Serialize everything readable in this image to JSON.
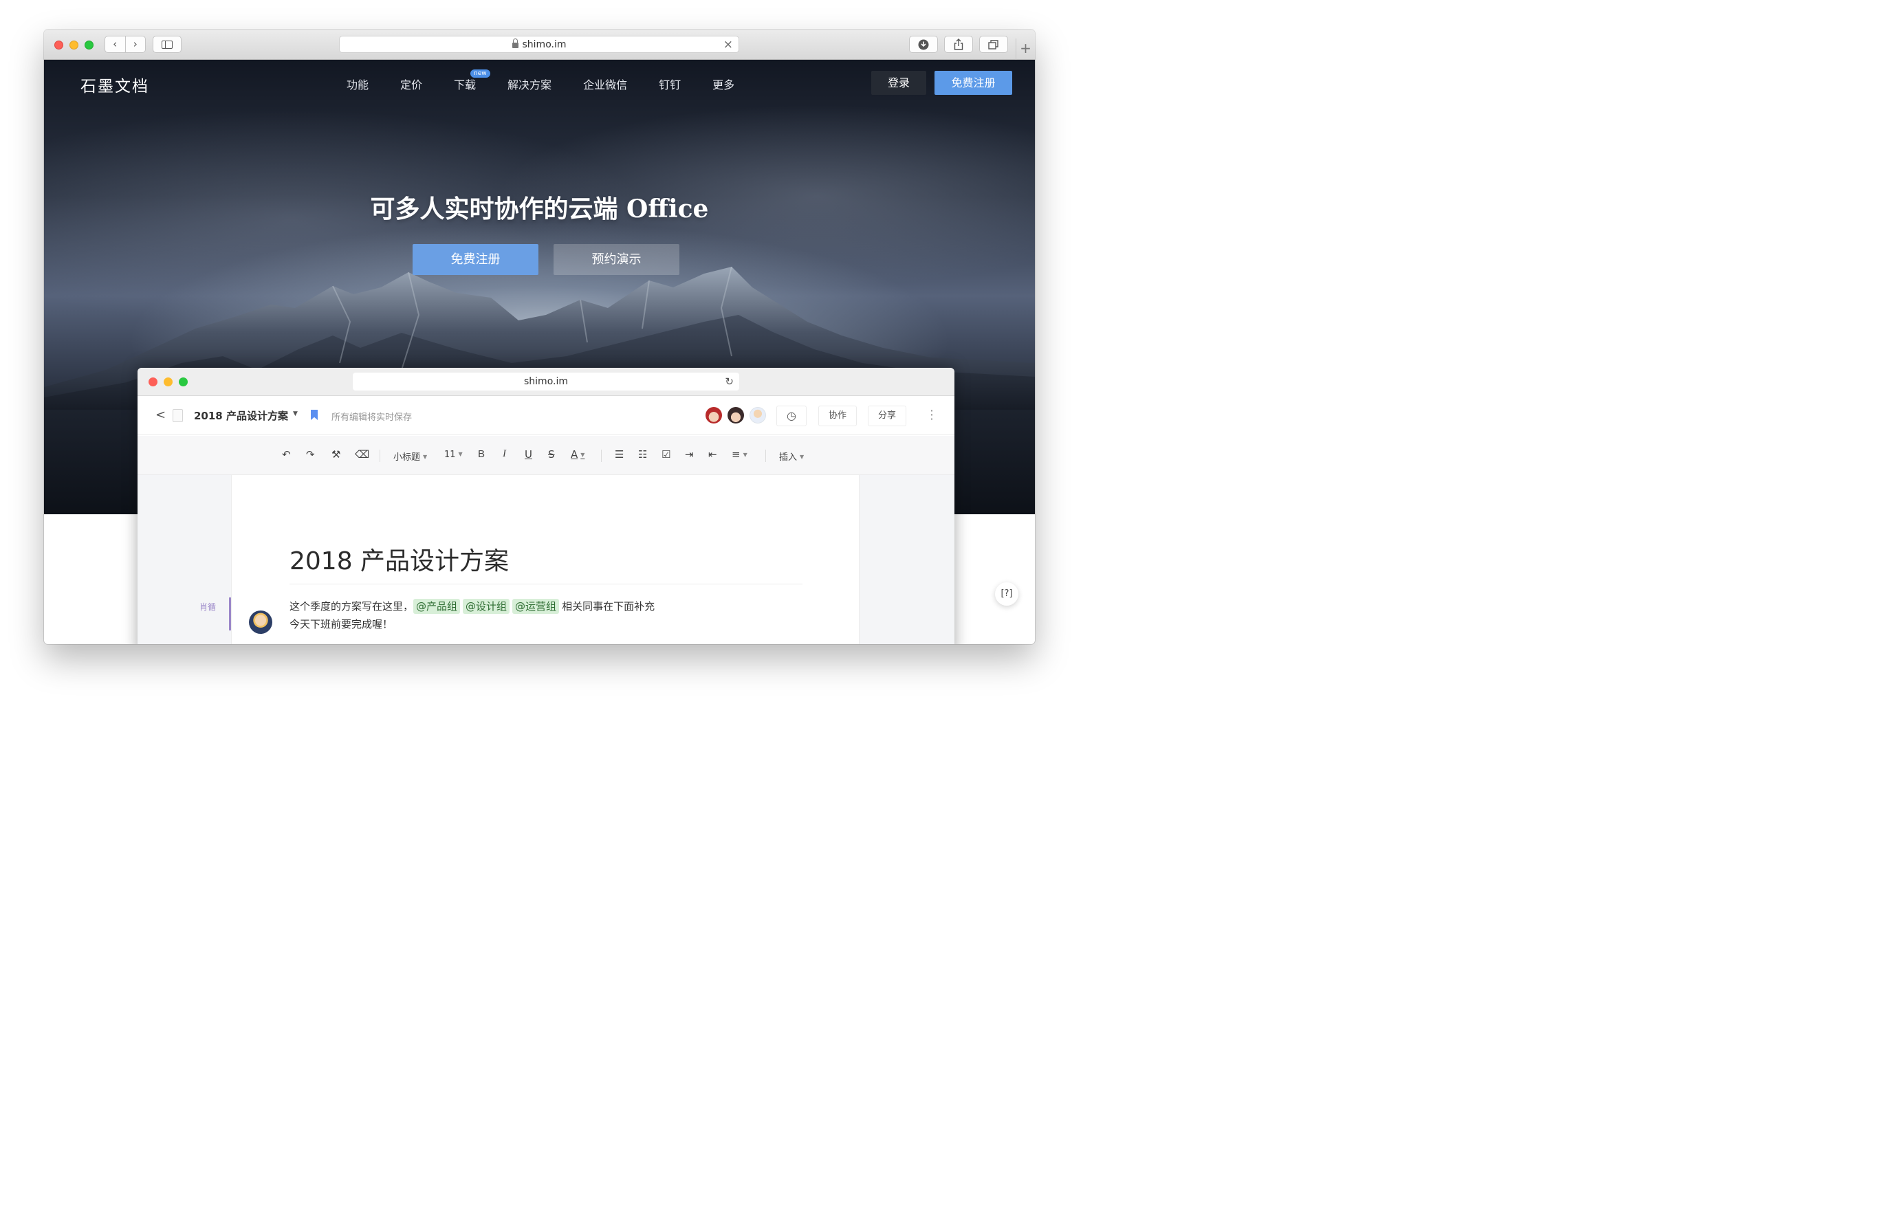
{
  "browser": {
    "url": "shimo.im",
    "nav_back": "‹",
    "nav_forward": "›",
    "clear": "×",
    "new_tab": "+"
  },
  "site": {
    "logo": "石墨文档",
    "nav": [
      "功能",
      "定价",
      "下载",
      "解决方案",
      "企业微信",
      "钉钉",
      "更多"
    ],
    "new_badge": "new",
    "login": "登录",
    "signup": "免费注册"
  },
  "hero": {
    "title": "可多人实时协作的云端 Office",
    "signup": "免费注册",
    "demo": "预约演示"
  },
  "editor": {
    "url": "shimo.im",
    "doc_title": "2018 产品设计方案",
    "save_status": "所有编辑将实时保存",
    "collab": "协作",
    "share": "分享",
    "toolbar": {
      "heading_style": "小标题",
      "font_size": "11",
      "bold": "B",
      "italic": "I",
      "underline": "U",
      "strike": "S",
      "font_color": "A",
      "insert": "插入"
    },
    "page_title": "2018 产品设计方案",
    "author": "肖循",
    "paragraph": {
      "line1_lead": "这个季度的方案写在这里，",
      "mentions": [
        "@产品组",
        "@设计组",
        "@运营组"
      ],
      "line1_tail": "相关同事在下面补充",
      "line2": "今天下班前要完成喔！"
    }
  },
  "colors": {
    "accent": "#5c9ae8",
    "mention_bg": "#d8efd8",
    "author": "#9b87c9"
  }
}
